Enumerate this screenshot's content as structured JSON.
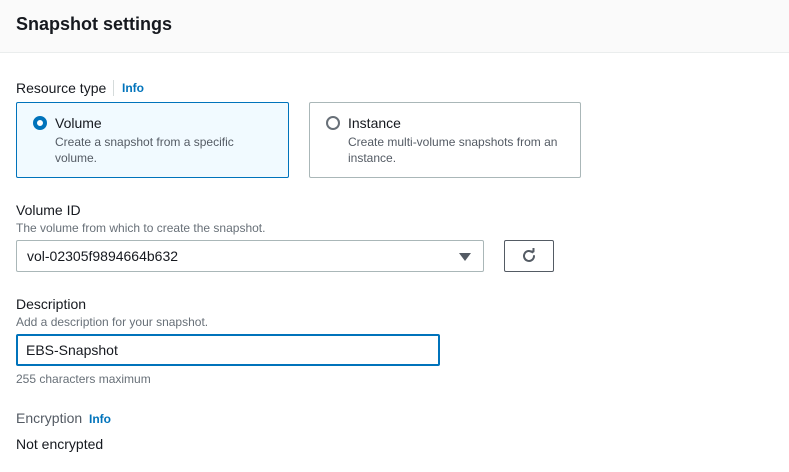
{
  "header": {
    "title": "Snapshot settings"
  },
  "resource_type": {
    "label": "Resource type",
    "info": "Info",
    "options": [
      {
        "title": "Volume",
        "description": "Create a snapshot from a specific volume.",
        "selected": true
      },
      {
        "title": "Instance",
        "description": "Create multi-volume snapshots from an instance.",
        "selected": false
      }
    ]
  },
  "volume_id": {
    "label": "Volume ID",
    "hint": "The volume from which to create the snapshot.",
    "value": "vol-02305f9894664b632",
    "refresh_icon": "refresh-icon"
  },
  "description": {
    "label": "Description",
    "hint": "Add a description for your snapshot.",
    "value": "EBS-Snapshot",
    "constraint": "255 characters maximum"
  },
  "encryption": {
    "label": "Encryption",
    "info": "Info",
    "value": "Not encrypted"
  },
  "colors": {
    "accent": "#0073bb",
    "selected_bg": "#f1faff",
    "text": "#16191f",
    "muted": "#687078"
  }
}
